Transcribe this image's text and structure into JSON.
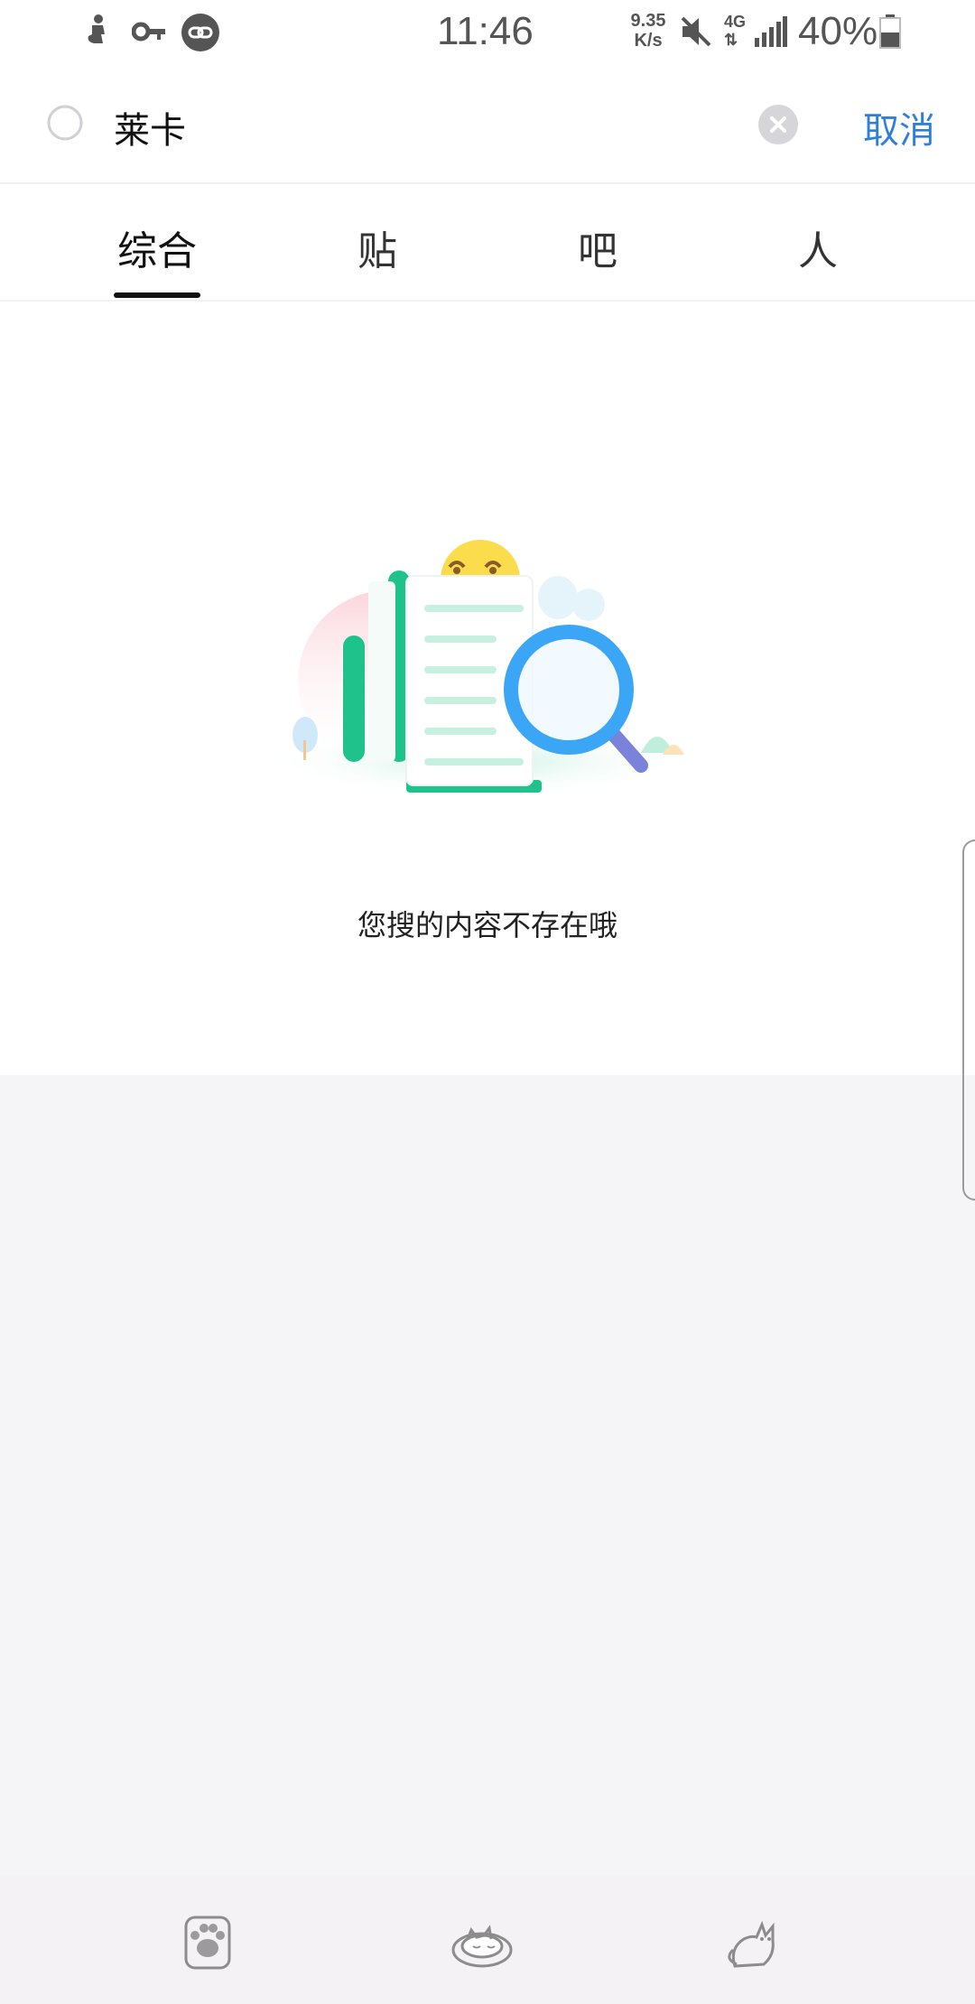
{
  "status_bar": {
    "time": "11:46",
    "speed_value": "9.35",
    "speed_unit": "K/s",
    "network_type": "4G",
    "battery_percent": "40%",
    "icons": [
      "notification-icon",
      "key-icon",
      "link-icon",
      "mute-icon",
      "signal-icon",
      "battery-icon"
    ]
  },
  "search": {
    "query": "莱卡",
    "cancel_label": "取消"
  },
  "tabs": [
    {
      "label": "综合",
      "active": true
    },
    {
      "label": "贴",
      "active": false
    },
    {
      "label": "吧",
      "active": false
    },
    {
      "label": "人",
      "active": false
    }
  ],
  "empty_state": {
    "message": "您搜的内容不存在哦"
  },
  "bottom_nav": {
    "items": [
      "paw-icon",
      "sleeping-cat-icon",
      "cat-icon"
    ]
  },
  "colors": {
    "accent_blue": "#2f7fd8",
    "illustration_green": "#1fc28a",
    "illustration_blue": "#3aa6f5"
  }
}
